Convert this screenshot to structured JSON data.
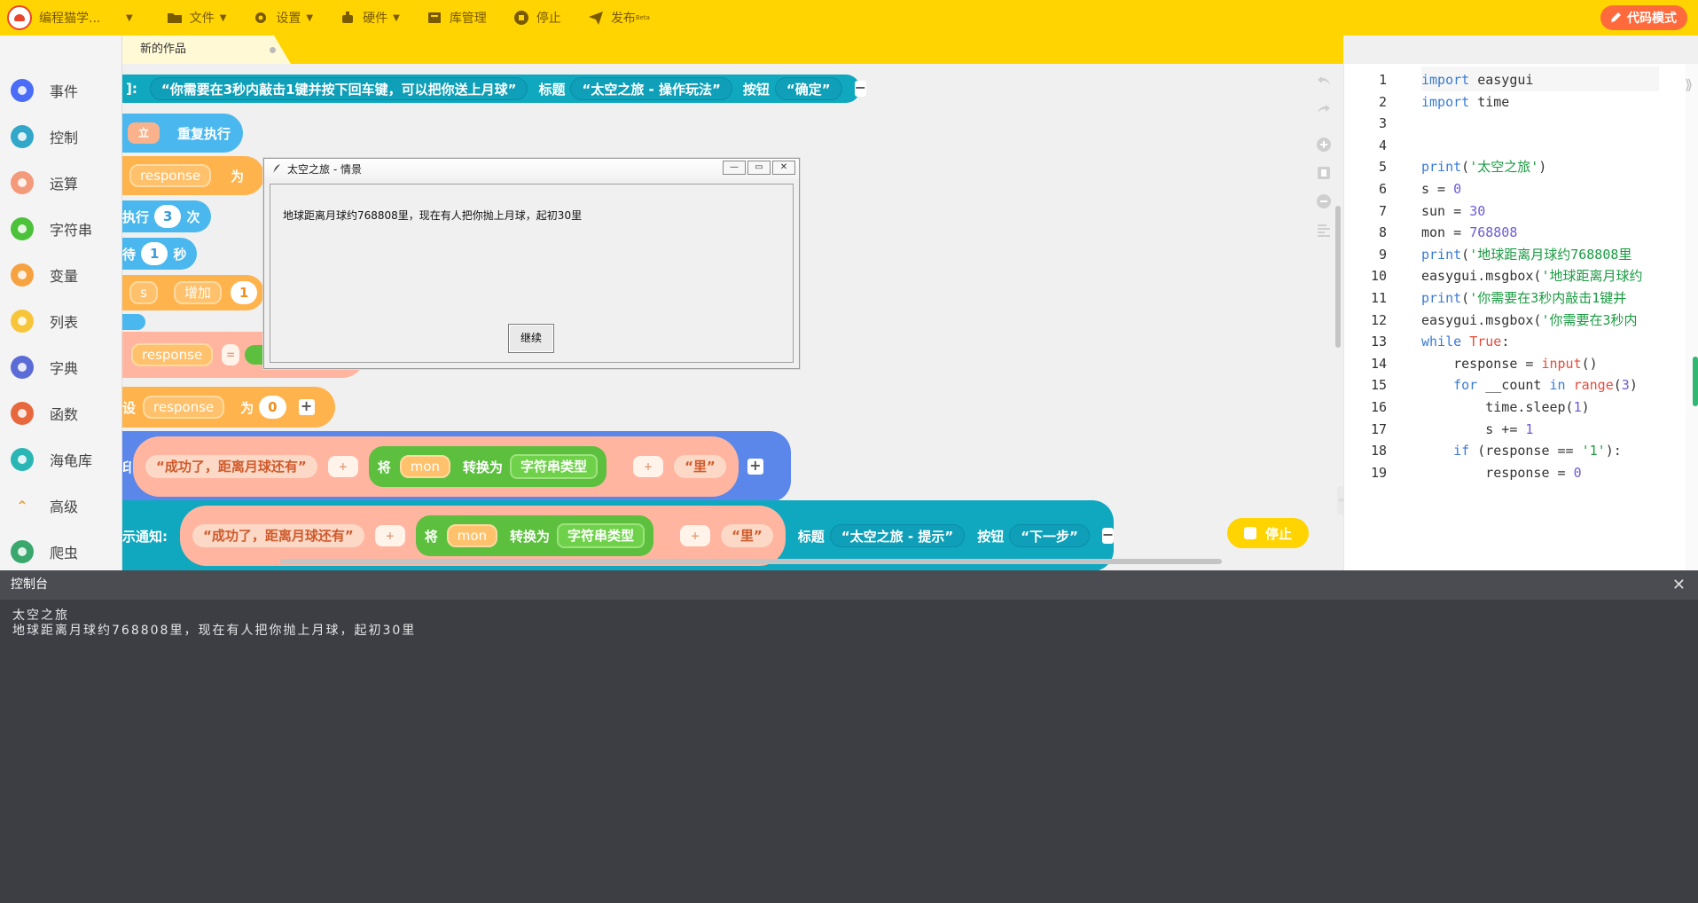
{
  "topbar": {
    "brand": "编程猫学...",
    "menus": [
      {
        "label": "文件",
        "icon": "folder-icon",
        "has_caret": true
      },
      {
        "label": "设置",
        "icon": "gear-icon",
        "has_caret": true
      },
      {
        "label": "硬件",
        "icon": "robot-icon",
        "has_caret": true
      },
      {
        "label": "库管理",
        "icon": "library-icon",
        "has_caret": false
      },
      {
        "label": "停止",
        "icon": "stop-icon",
        "has_caret": false
      },
      {
        "label": "发布",
        "icon": "send-icon",
        "has_caret": false
      }
    ],
    "publish_sup": "Beta",
    "code_mode": "代码模式",
    "accent": "#ffd400"
  },
  "sidebar": {
    "items": [
      {
        "label": "事件",
        "icon": "event-icon",
        "color": "#4a6cf7"
      },
      {
        "label": "控制",
        "icon": "gamepad-icon",
        "color": "#32a7c9"
      },
      {
        "label": "运算",
        "icon": "calc-icon",
        "color": "#f39a7a"
      },
      {
        "label": "字符串",
        "icon": "string-icon",
        "color": "#4cc13a"
      },
      {
        "label": "变量",
        "icon": "variable-icon",
        "color": "#f7a241"
      },
      {
        "label": "列表",
        "icon": "list-icon",
        "color": "#f7c53a"
      },
      {
        "label": "字典",
        "icon": "dict-icon",
        "color": "#5c6cd6"
      },
      {
        "label": "函数",
        "icon": "function-icon",
        "color": "#e8683e"
      },
      {
        "label": "海龟库",
        "icon": "turtle-icon",
        "color": "#2bb6b6"
      },
      {
        "label": "高级",
        "icon": "chevron-up-icon",
        "color": "#f4f4f4"
      },
      {
        "label": "爬虫",
        "icon": "spider-icon",
        "color": "#3aa76d"
      }
    ]
  },
  "tab": {
    "label": "新的作品"
  },
  "blocks": {
    "row1_prefix": "]:",
    "row1_msg": "“你需要在3秒内敲击1键并按下回车键，可以把你送上月球”",
    "row1_title_label": "标题",
    "row1_title": "“太空之旅 - 操作玩法”",
    "row1_btn_label": "按钮",
    "row1_btn": "“确定”",
    "row2_prefix": "立",
    "row2_label": "重复执行",
    "row3_var": "response",
    "row3_as": "为",
    "row4_prefix": "执行",
    "row4_num": "3",
    "row4_unit": "次",
    "row5_prefix": "待",
    "row5_num": "1",
    "row5_unit": "秒",
    "row6_var": "s",
    "row6_op": "增加",
    "row6_num": "1",
    "row7_var": "response",
    "row7_op": "=",
    "row8_prefix": "设",
    "row8_var": "response",
    "row8_as": "为",
    "row8_num": "0",
    "row9_prefix": "印",
    "row9_str": "“成功了，距离月球还有”",
    "row9_plus": "+",
    "row9_convert": "将",
    "row9_var": "mon",
    "row9_to": "转换为",
    "row9_type": "字符串类型",
    "row9_plus2": "+",
    "row9_end": "“里”",
    "row10_prefix": "示通知:",
    "row10_str": "“成功了，距离月球还有”",
    "row10_plus": "+",
    "row10_convert": "将",
    "row10_var": "mon",
    "row10_to": "转换为",
    "row10_type": "字符串类型",
    "row10_plus2": "+",
    "row10_end": "“里”",
    "row10_title_label": "标题",
    "row10_title": "“太空之旅 - 提示”",
    "row10_btn_label": "按钮",
    "row10_btn": "“下一步”",
    "stop_label": "停止"
  },
  "dialog": {
    "title": "太空之旅 - 情景",
    "message": "地球距离月球约768808里，现在有人把你抛上月球，起初30里",
    "button": "继续"
  },
  "editor": {
    "lines": [
      {
        "n": "1",
        "html": "<span class='kw'>import</span> easygui"
      },
      {
        "n": "2",
        "html": "<span class='kw'>import</span> time"
      },
      {
        "n": "3",
        "html": ""
      },
      {
        "n": "4",
        "html": ""
      },
      {
        "n": "5",
        "html": "<span class='kw'>print</span>(<span class='str'>'太空之旅'</span>)"
      },
      {
        "n": "6",
        "html": "s = <span class='num'>0</span>"
      },
      {
        "n": "7",
        "html": "sun = <span class='num'>30</span>"
      },
      {
        "n": "8",
        "html": "mon = <span class='num'>768808</span>"
      },
      {
        "n": "9",
        "html": "<span class='kw'>print</span>(<span class='str'>'地球距离月球约768808里</span>"
      },
      {
        "n": "10",
        "html": "easygui.msgbox(<span class='str'>'地球距离月球约</span>"
      },
      {
        "n": "11",
        "html": "<span class='kw'>print</span>(<span class='str'>'你需要在3秒内敲击1键并</span>"
      },
      {
        "n": "12",
        "html": "easygui.msgbox(<span class='str'>'你需要在3秒内</span>"
      },
      {
        "n": "13",
        "html": "<span class='kw'>while</span> <span class='fn'>True</span>:"
      },
      {
        "n": "14",
        "html": "    response = <span class='fn'>input</span>()"
      },
      {
        "n": "15",
        "html": "    <span class='kw'>for</span> __count <span class='kw'>in</span> <span class='fn'>range</span>(<span class='num'>3</span>)"
      },
      {
        "n": "16",
        "html": "        time.sleep(<span class='num'>1</span>)"
      },
      {
        "n": "17",
        "html": "        s += <span class='num'>1</span>"
      },
      {
        "n": "18",
        "html": "    <span class='kw'>if</span> (response == <span class='str'>'1'</span>):"
      },
      {
        "n": "19",
        "html": "        response = <span class='num'>0</span>"
      }
    ]
  },
  "console": {
    "title": "控制台",
    "lines": [
      "太空之旅",
      "地球距离月球约768808里，现在有人把你抛上月球，起初30里"
    ]
  }
}
